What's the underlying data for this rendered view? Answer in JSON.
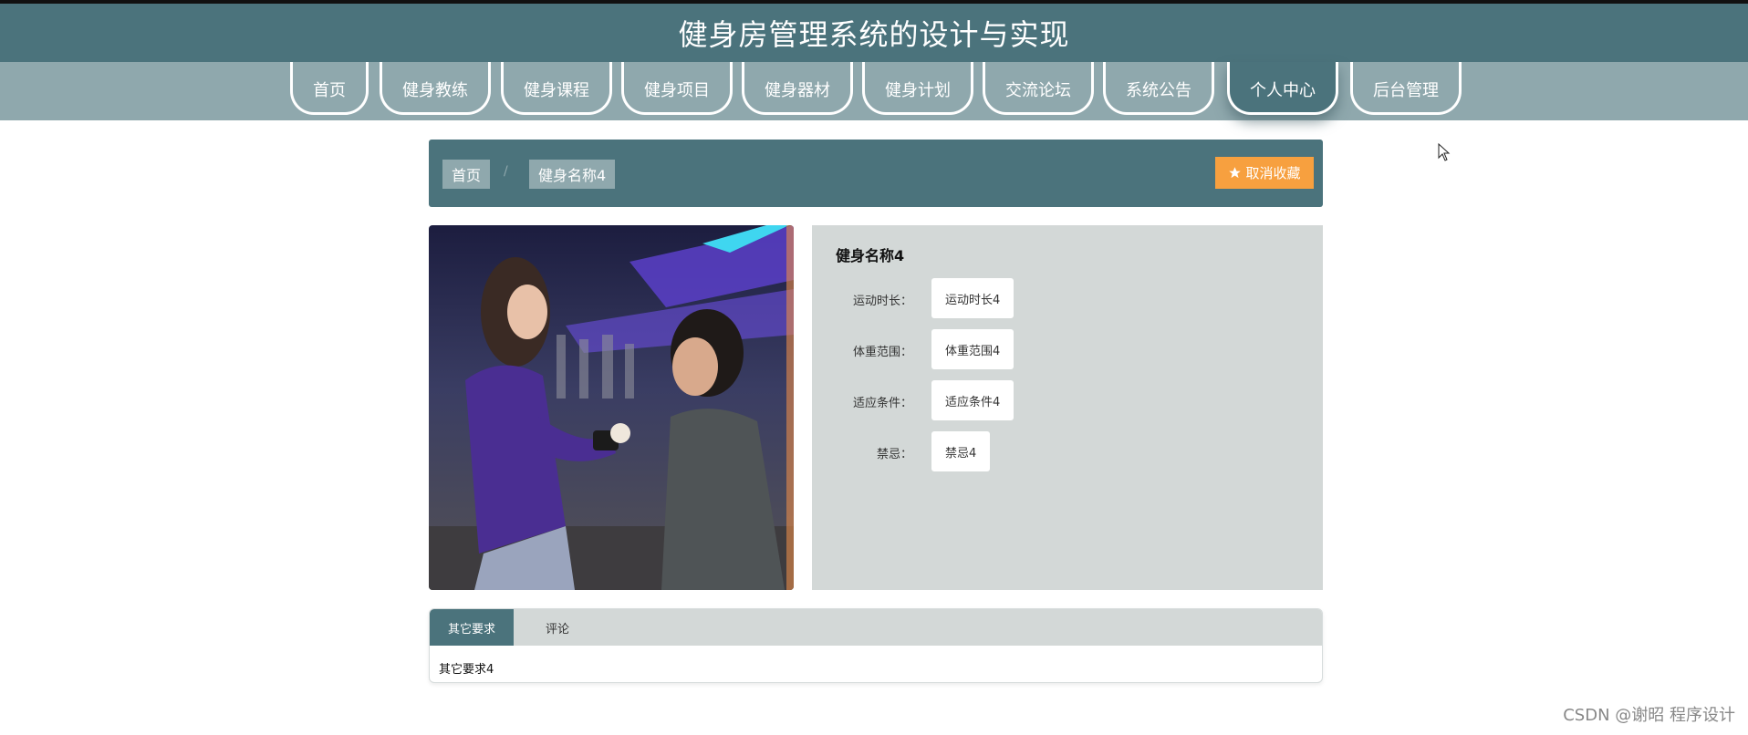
{
  "header": {
    "title": "健身房管理系统的设计与实现"
  },
  "nav": {
    "items": [
      {
        "label": "首页"
      },
      {
        "label": "健身教练"
      },
      {
        "label": "健身课程"
      },
      {
        "label": "健身项目"
      },
      {
        "label": "健身器材"
      },
      {
        "label": "健身计划"
      },
      {
        "label": "交流论坛"
      },
      {
        "label": "系统公告"
      },
      {
        "label": "个人中心"
      },
      {
        "label": "后台管理"
      }
    ],
    "active": "个人中心"
  },
  "breadcrumb": {
    "home": "首页",
    "separator": "/",
    "current": "健身名称4",
    "favorite_button": "取消收藏",
    "favorite_icon": "star-icon"
  },
  "detail": {
    "title": "健身名称4",
    "fields": [
      {
        "label": "运动时长：",
        "value": "运动时长4"
      },
      {
        "label": "体重范围：",
        "value": "体重范围4"
      },
      {
        "label": "适应条件：",
        "value": "适应条件4"
      },
      {
        "label": "禁忌：",
        "value": "禁忌4"
      }
    ]
  },
  "tabs": {
    "items": [
      {
        "label": "其它要求"
      },
      {
        "label": "评论"
      }
    ],
    "active": "其它要求",
    "content": "其它要求4"
  },
  "watermark": "CSDN @谢昭  程序设计",
  "colors": {
    "primary": "#4b737c",
    "nav_bg": "#8fa8ad",
    "panel_bg": "#d3d8d7",
    "accent": "#f7a03f"
  }
}
